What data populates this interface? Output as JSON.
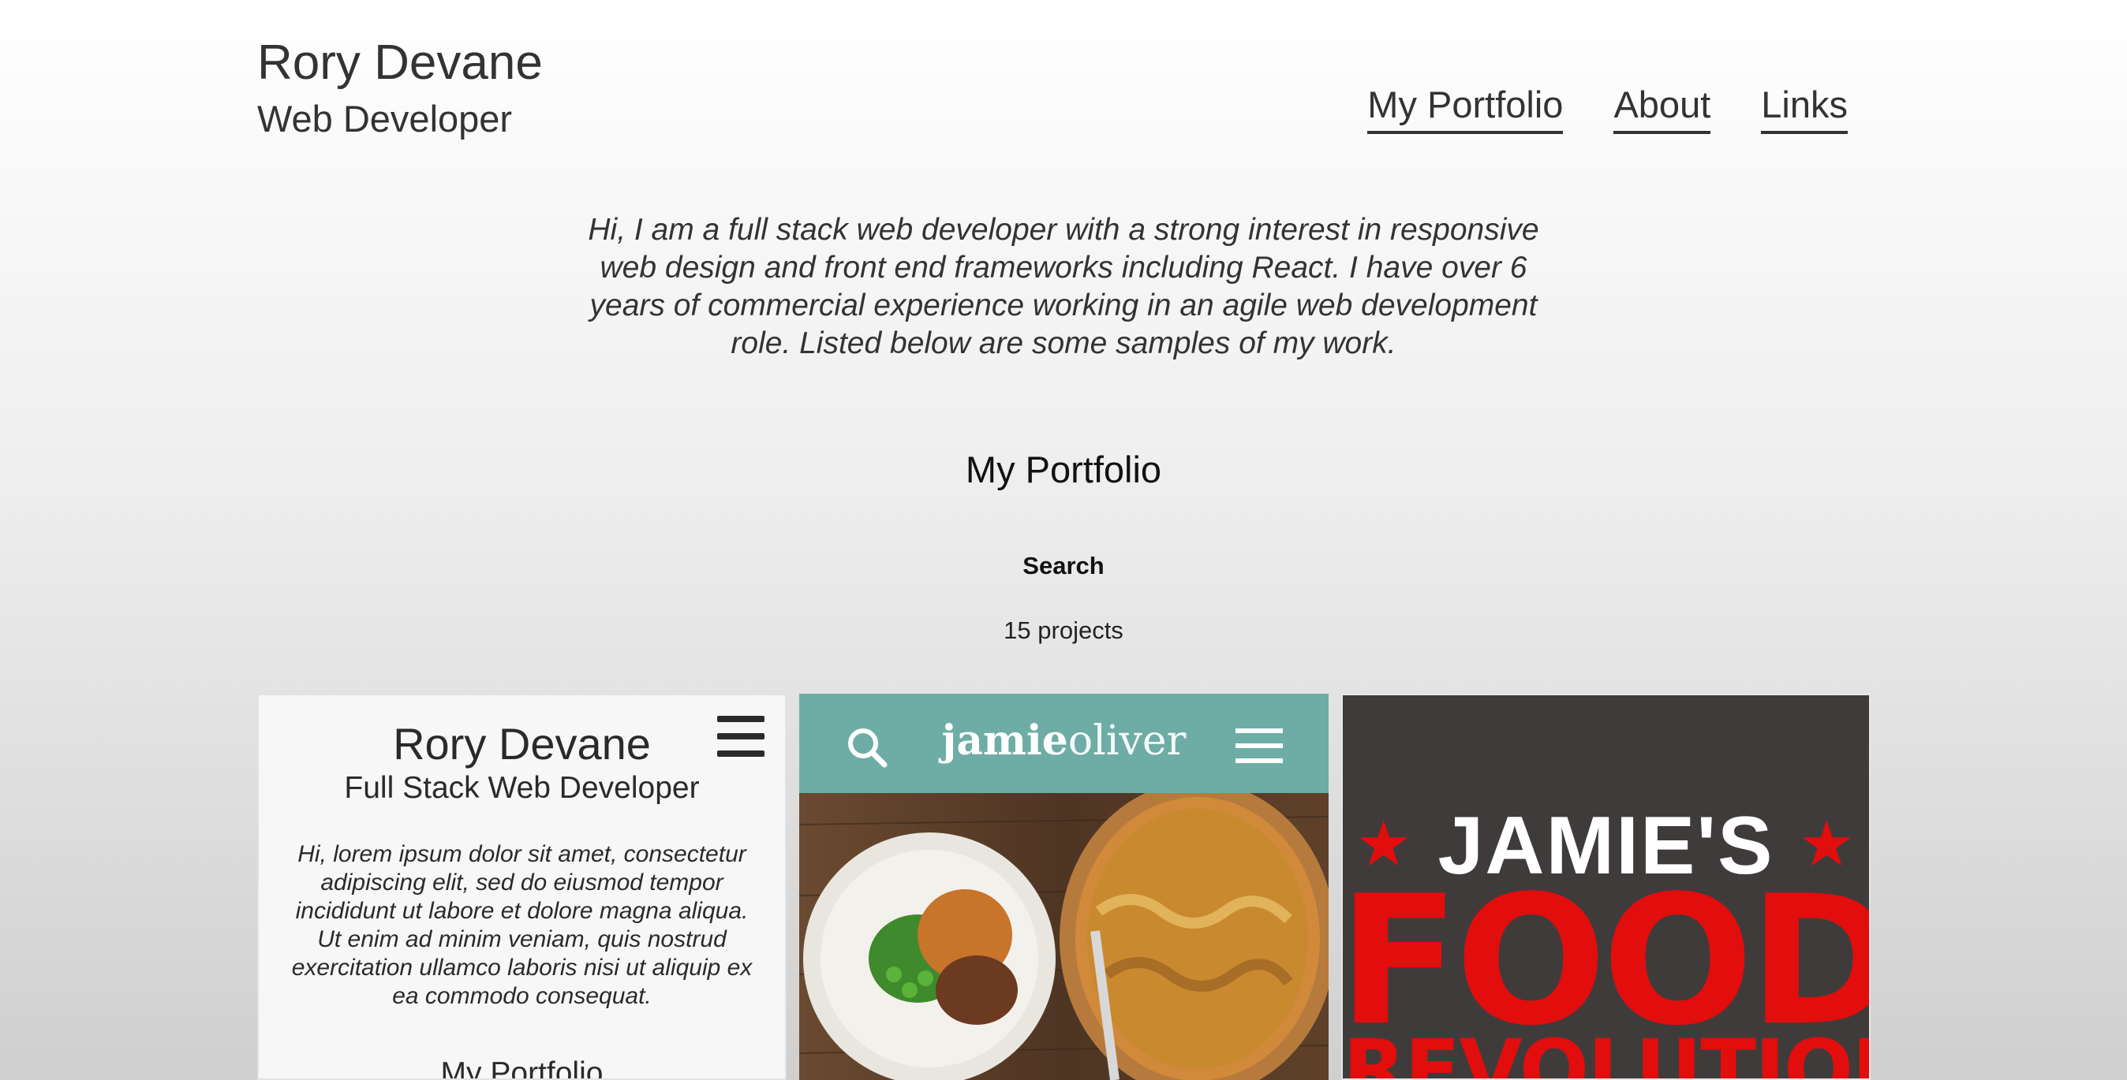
{
  "header": {
    "name": "Rory Devane",
    "role": "Web Developer"
  },
  "nav": {
    "items": [
      "My Portfolio",
      "About",
      "Links"
    ]
  },
  "intro": "Hi, I am a full stack web developer with a strong interest in responsive web design and front end frameworks including React. I have over 6 years of commercial experience working in an agile web development role. Listed below are some samples of my work.",
  "portfolio": {
    "title": "My Portfolio",
    "search_label": "Search",
    "count_text": "15 projects"
  },
  "projects": [
    {
      "title": "Rory Devane",
      "subtitle": "Full Stack Web Developer",
      "text": "Hi, lorem ipsum dolor sit amet, consectetur adipiscing elit, sed do eiusmod tempor incididunt ut labore et dolore magna aliqua. Ut enim ad minim veniam, quis nostrud exercitation ullamco laboris nisi ut aliquip ex ea commodo consequat.",
      "section": "My Portfolio"
    },
    {
      "logo_bold": "jamie",
      "logo_light": "oliver"
    },
    {
      "line1": "JAMIE'S",
      "line2": "FOOD",
      "line3": "REVOLUTION"
    }
  ]
}
